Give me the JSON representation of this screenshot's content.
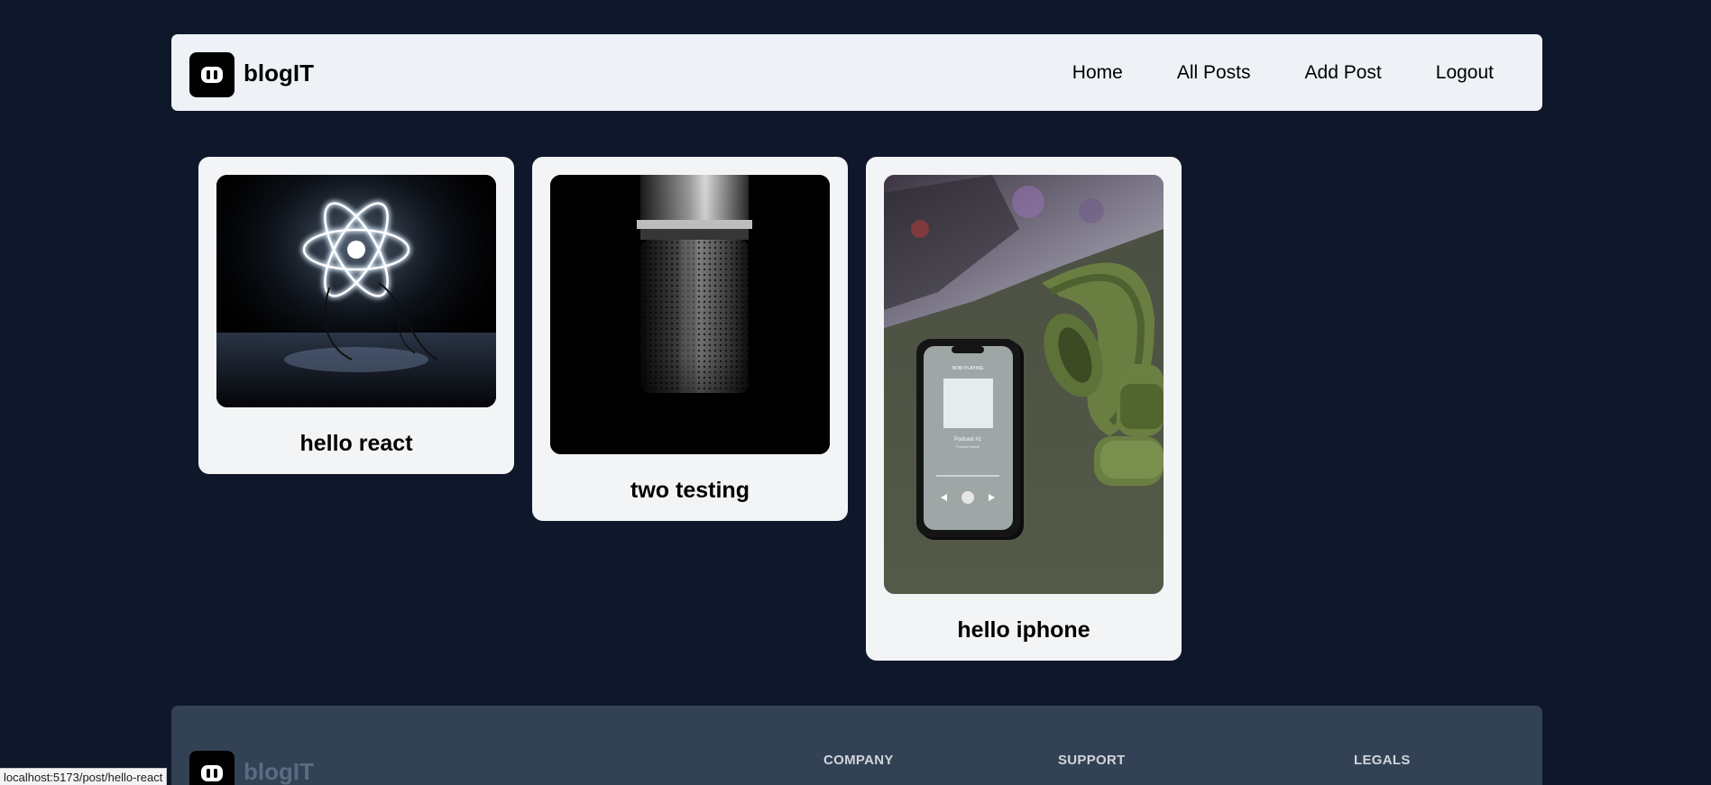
{
  "header": {
    "brand": "blogIT",
    "nav": [
      {
        "label": "Home"
      },
      {
        "label": "All Posts"
      },
      {
        "label": "Add Post"
      },
      {
        "label": "Logout"
      }
    ]
  },
  "posts": [
    {
      "title": "hello react"
    },
    {
      "title": "two testing"
    },
    {
      "title": "hello iphone",
      "phone_title": "NOW PLAYING",
      "track": "Podcast #1",
      "artist": "Podcast Name"
    }
  ],
  "footer": {
    "brand": "blogIT",
    "columns": [
      {
        "heading": "COMPANY"
      },
      {
        "heading": "SUPPORT"
      },
      {
        "heading": "LEGALS"
      }
    ]
  },
  "status_bar": {
    "url": "localhost:5173/post/hello-react"
  }
}
